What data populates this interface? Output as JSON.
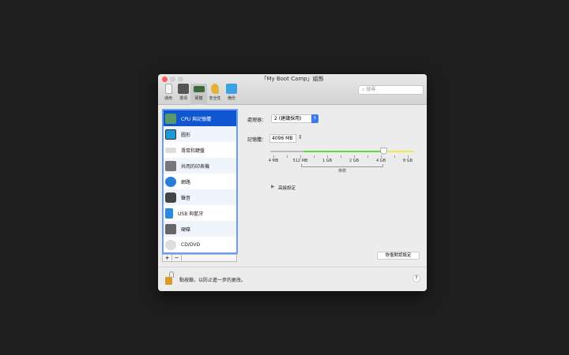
{
  "window": {
    "title": "「My Boot Camp」組態"
  },
  "toolbar": {
    "items": [
      {
        "label": "通用"
      },
      {
        "label": "選項"
      },
      {
        "label": "硬體"
      },
      {
        "label": "安全性"
      },
      {
        "label": "備份"
      }
    ],
    "search_placeholder": "搜尋"
  },
  "sidebar": {
    "items": [
      {
        "label": "CPU 與記憶體"
      },
      {
        "label": "圖形"
      },
      {
        "label": "滑鼠和鍵盤"
      },
      {
        "label": "共用的印表機"
      },
      {
        "label": "網路"
      },
      {
        "label": "聲音"
      },
      {
        "label": "USB 與藍牙"
      },
      {
        "label": "硬碟"
      },
      {
        "label": "CD/DVD"
      }
    ],
    "add": "+",
    "remove": "−"
  },
  "main": {
    "cpu_label": "處理器：",
    "cpu_value": "2 (建議採用)",
    "mem_label": "記憶體：",
    "mem_value": "4096 MB",
    "slider_ticks": [
      "4 MB",
      "512 MB",
      "1 GB",
      "2 GB",
      "4 GB",
      "8 GB"
    ],
    "recommended": "推薦",
    "advanced": "高級設定",
    "restore": "恢復默認設定"
  },
  "footer": {
    "lock_text": "點按鎖，以防止進一步的更改。",
    "help": "?"
  }
}
